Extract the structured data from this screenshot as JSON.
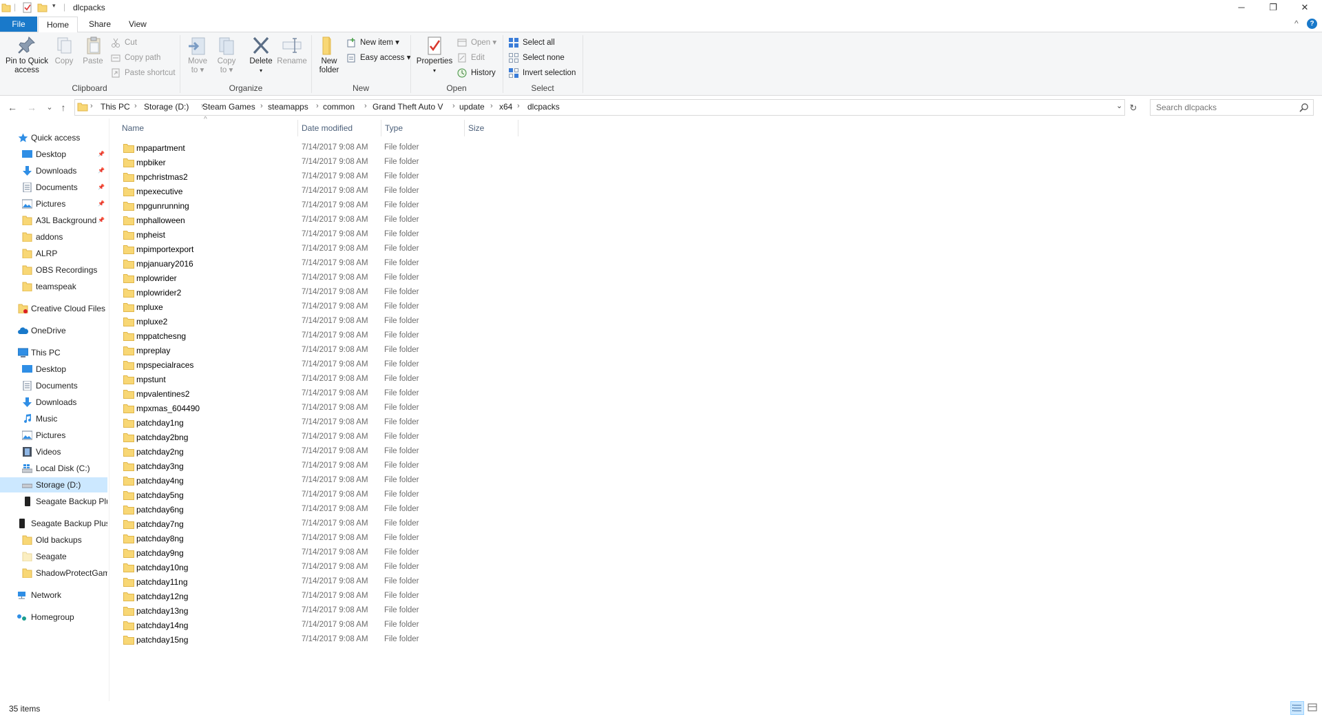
{
  "window": {
    "title": "dlcpacks",
    "minimize": "─",
    "maximize": "❐",
    "close": "✕",
    "collapse_ribbon": "^",
    "help": "?"
  },
  "tabs": [
    {
      "label": "File"
    },
    {
      "label": "Home"
    },
    {
      "label": "Share"
    },
    {
      "label": "View"
    }
  ],
  "ribbon": {
    "clipboard": {
      "label": "Clipboard",
      "pin_line1": "Pin to Quick",
      "pin_line2": "access",
      "copy": "Copy",
      "paste": "Paste",
      "cut": "Cut",
      "copy_path": "Copy path",
      "paste_shortcut": "Paste shortcut"
    },
    "organize": {
      "label": "Organize",
      "move_line1": "Move",
      "move_line2": "to ▾",
      "copy_line1": "Copy",
      "copy_line2": "to ▾",
      "delete": "Delete",
      "delete_arrow": "▾",
      "rename": "Rename"
    },
    "new": {
      "label": "New",
      "folder_line1": "New",
      "folder_line2": "folder",
      "new_item": "New item ▾",
      "easy_access": "Easy access ▾"
    },
    "open": {
      "label": "Open",
      "properties": "Properties",
      "properties_arrow": "▾",
      "open": "Open ▾",
      "edit": "Edit",
      "history": "History"
    },
    "select": {
      "label": "Select",
      "select_all": "Select all",
      "select_none": "Select none",
      "invert": "Invert selection"
    }
  },
  "nav": {
    "back": "←",
    "forward": "→",
    "recent": "⌄",
    "up": "↑",
    "refresh": "↻",
    "dropdown": "⌄"
  },
  "breadcrumb": [
    "This PC",
    "Storage (D:)",
    "Steam Games",
    "steamapps",
    "common",
    "Grand Theft Auto V",
    "update",
    "x64",
    "dlcpacks"
  ],
  "search": {
    "placeholder": "Search dlcpacks"
  },
  "sidebar": {
    "quick_access": "Quick access",
    "quick_items": [
      {
        "label": "Desktop",
        "pinned": true
      },
      {
        "label": "Downloads",
        "pinned": true
      },
      {
        "label": "Documents",
        "pinned": true
      },
      {
        "label": "Pictures",
        "pinned": true
      },
      {
        "label": "A3L Background",
        "pinned": true
      },
      {
        "label": "addons"
      },
      {
        "label": "ALRP"
      },
      {
        "label": "OBS Recordings"
      },
      {
        "label": "teamspeak"
      }
    ],
    "creative_cloud": "Creative Cloud Files",
    "onedrive": "OneDrive",
    "this_pc": "This PC",
    "pc_items": [
      {
        "label": "Desktop"
      },
      {
        "label": "Documents"
      },
      {
        "label": "Downloads"
      },
      {
        "label": "Music"
      },
      {
        "label": "Pictures"
      },
      {
        "label": "Videos"
      },
      {
        "label": "Local Disk (C:)"
      },
      {
        "label": "Storage (D:)",
        "selected": true
      },
      {
        "label": "Seagate Backup Plu"
      }
    ],
    "seagate": "Seagate Backup Plus",
    "seagate_items": [
      {
        "label": "Old backups"
      },
      {
        "label": "Seagate"
      },
      {
        "label": "ShadowProtectGam"
      }
    ],
    "network": "Network",
    "homegroup": "Homegroup",
    "pin_glyph": "📌"
  },
  "columns": {
    "name": "Name",
    "date": "Date modified",
    "type": "Type",
    "size": "Size",
    "sort_glyph": "^"
  },
  "files": [
    {
      "name": "mpapartment",
      "date": "7/14/2017 9:08 AM",
      "type": "File folder"
    },
    {
      "name": "mpbiker",
      "date": "7/14/2017 9:08 AM",
      "type": "File folder"
    },
    {
      "name": "mpchristmas2",
      "date": "7/14/2017 9:08 AM",
      "type": "File folder"
    },
    {
      "name": "mpexecutive",
      "date": "7/14/2017 9:08 AM",
      "type": "File folder"
    },
    {
      "name": "mpgunrunning",
      "date": "7/14/2017 9:08 AM",
      "type": "File folder"
    },
    {
      "name": "mphalloween",
      "date": "7/14/2017 9:08 AM",
      "type": "File folder"
    },
    {
      "name": "mpheist",
      "date": "7/14/2017 9:08 AM",
      "type": "File folder"
    },
    {
      "name": "mpimportexport",
      "date": "7/14/2017 9:08 AM",
      "type": "File folder"
    },
    {
      "name": "mpjanuary2016",
      "date": "7/14/2017 9:08 AM",
      "type": "File folder"
    },
    {
      "name": "mplowrider",
      "date": "7/14/2017 9:08 AM",
      "type": "File folder"
    },
    {
      "name": "mplowrider2",
      "date": "7/14/2017 9:08 AM",
      "type": "File folder"
    },
    {
      "name": "mpluxe",
      "date": "7/14/2017 9:08 AM",
      "type": "File folder"
    },
    {
      "name": "mpluxe2",
      "date": "7/14/2017 9:08 AM",
      "type": "File folder"
    },
    {
      "name": "mppatchesng",
      "date": "7/14/2017 9:08 AM",
      "type": "File folder"
    },
    {
      "name": "mpreplay",
      "date": "7/14/2017 9:08 AM",
      "type": "File folder"
    },
    {
      "name": "mpspecialraces",
      "date": "7/14/2017 9:08 AM",
      "type": "File folder"
    },
    {
      "name": "mpstunt",
      "date": "7/14/2017 9:08 AM",
      "type": "File folder"
    },
    {
      "name": "mpvalentines2",
      "date": "7/14/2017 9:08 AM",
      "type": "File folder"
    },
    {
      "name": "mpxmas_604490",
      "date": "7/14/2017 9:08 AM",
      "type": "File folder"
    },
    {
      "name": "patchday1ng",
      "date": "7/14/2017 9:08 AM",
      "type": "File folder"
    },
    {
      "name": "patchday2bng",
      "date": "7/14/2017 9:08 AM",
      "type": "File folder"
    },
    {
      "name": "patchday2ng",
      "date": "7/14/2017 9:08 AM",
      "type": "File folder"
    },
    {
      "name": "patchday3ng",
      "date": "7/14/2017 9:08 AM",
      "type": "File folder"
    },
    {
      "name": "patchday4ng",
      "date": "7/14/2017 9:08 AM",
      "type": "File folder"
    },
    {
      "name": "patchday5ng",
      "date": "7/14/2017 9:08 AM",
      "type": "File folder"
    },
    {
      "name": "patchday6ng",
      "date": "7/14/2017 9:08 AM",
      "type": "File folder"
    },
    {
      "name": "patchday7ng",
      "date": "7/14/2017 9:08 AM",
      "type": "File folder"
    },
    {
      "name": "patchday8ng",
      "date": "7/14/2017 9:08 AM",
      "type": "File folder"
    },
    {
      "name": "patchday9ng",
      "date": "7/14/2017 9:08 AM",
      "type": "File folder"
    },
    {
      "name": "patchday10ng",
      "date": "7/14/2017 9:08 AM",
      "type": "File folder"
    },
    {
      "name": "patchday11ng",
      "date": "7/14/2017 9:08 AM",
      "type": "File folder"
    },
    {
      "name": "patchday12ng",
      "date": "7/14/2017 9:08 AM",
      "type": "File folder"
    },
    {
      "name": "patchday13ng",
      "date": "7/14/2017 9:08 AM",
      "type": "File folder"
    },
    {
      "name": "patchday14ng",
      "date": "7/14/2017 9:08 AM",
      "type": "File folder"
    },
    {
      "name": "patchday15ng",
      "date": "7/14/2017 9:08 AM",
      "type": "File folder"
    }
  ],
  "status": {
    "item_count": "35 items"
  },
  "colors": {
    "accent": "#1979ca",
    "folder": "#f8d775",
    "folder_dark": "#e0b64a",
    "selection": "#cce8ff"
  }
}
